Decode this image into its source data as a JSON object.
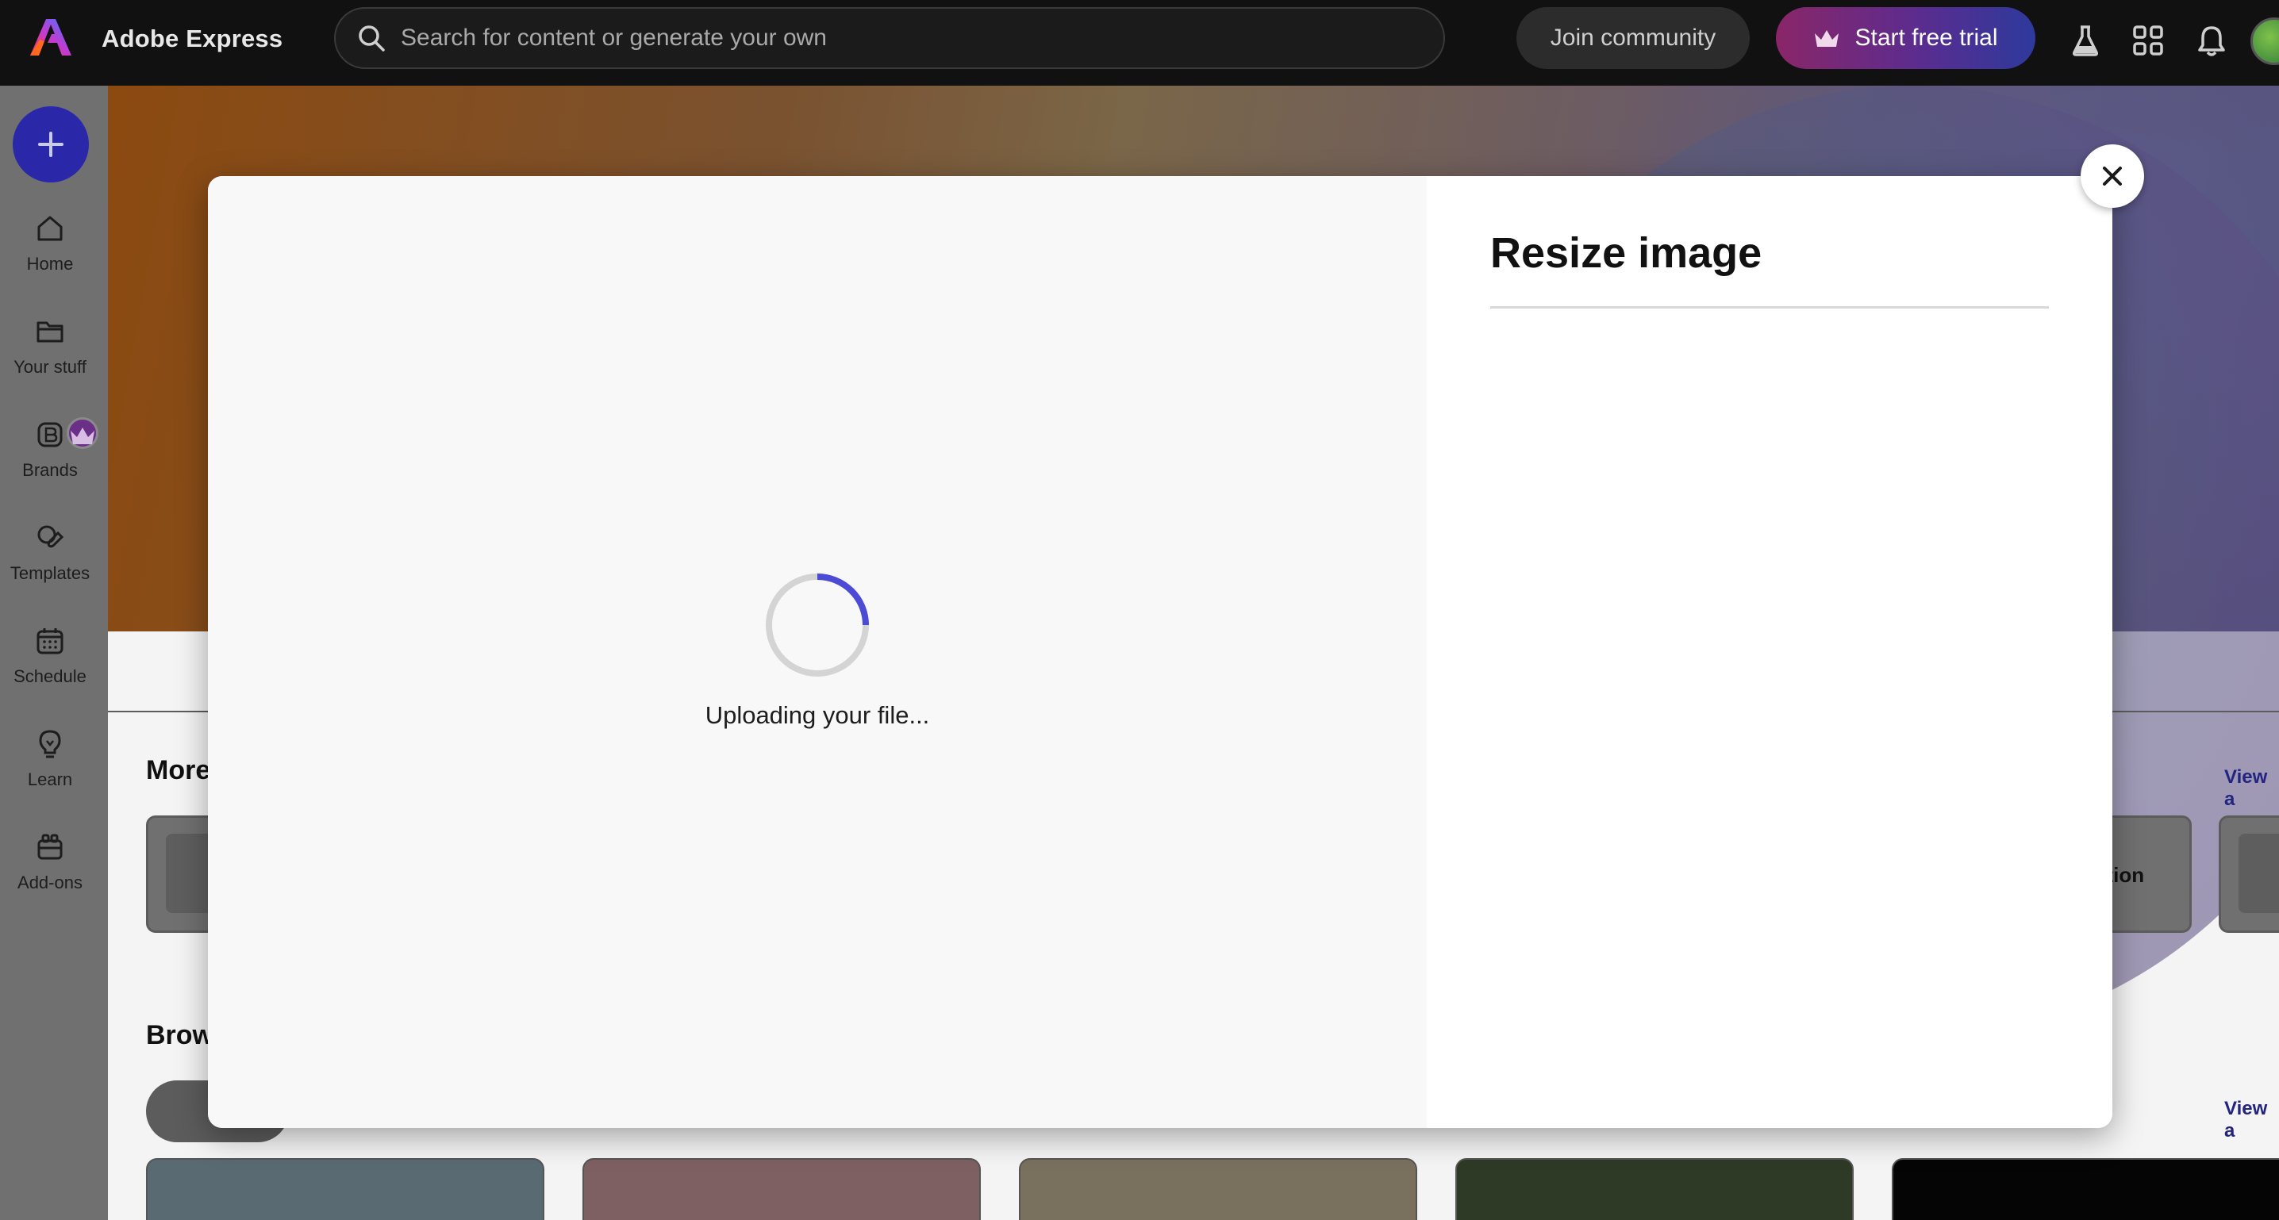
{
  "app": {
    "name": "Adobe Express"
  },
  "topbar": {
    "search_placeholder": "Search for content or generate your own",
    "join_label": "Join community",
    "trial_label": "Start free trial",
    "icons": [
      "flask-icon",
      "apps-grid-icon",
      "bell-icon"
    ]
  },
  "rail": {
    "items": [
      {
        "label": "Home",
        "icon": "home-icon"
      },
      {
        "label": "Your stuff",
        "icon": "folder-icon"
      },
      {
        "label": "Brands",
        "icon": "brand-icon"
      },
      {
        "label": "Templates",
        "icon": "templates-icon"
      },
      {
        "label": "Schedule",
        "icon": "calendar-icon"
      },
      {
        "label": "Learn",
        "icon": "lightbulb-icon"
      },
      {
        "label": "Add-ons",
        "icon": "addons-icon"
      }
    ]
  },
  "background": {
    "section1_heading": "More",
    "section2_heading": "Brow",
    "view_all_1": "View a",
    "view_all_2": "View a",
    "card_label": "ation"
  },
  "modal": {
    "title": "Resize image",
    "status_text": "Uploading your file..."
  },
  "colors": {
    "topbar_bg": "#111111",
    "accent_blue": "#2a28a8",
    "spinner_accent": "#4b4bd6",
    "trial_gradient_start": "#8a2668",
    "trial_gradient_end": "#2d3a9c"
  }
}
